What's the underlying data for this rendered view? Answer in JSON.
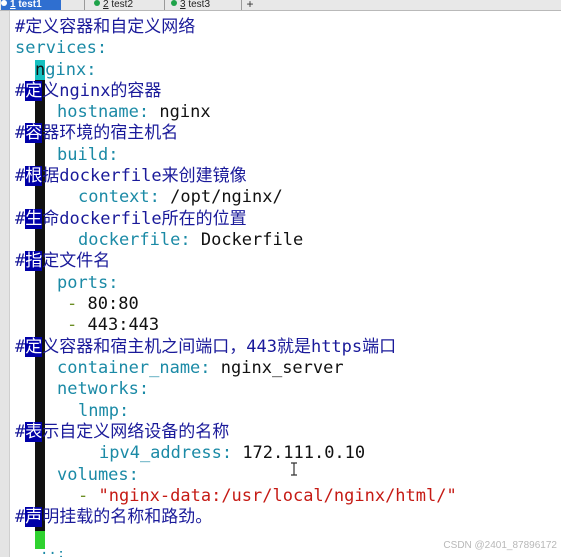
{
  "tabs": [
    {
      "num": "1",
      "label": "test1",
      "active": true
    },
    {
      "num": "2",
      "label": "test2",
      "active": false
    },
    {
      "num": "3",
      "label": "test3",
      "active": false
    }
  ],
  "new_tab_label": "+",
  "code_lines": [
    {
      "comment": "定义容器和自定义网络"
    },
    {
      "key": "services"
    },
    {
      "key_prefix": "n",
      "key": "ginx"
    },
    {
      "comment_first": "定",
      "comment": "义nginx的容器"
    },
    {
      "key": "hostname",
      "value": "nginx"
    },
    {
      "comment_first": "容",
      "comment": "器环境的宿主机名"
    },
    {
      "key": "build"
    },
    {
      "comment_first": "根",
      "comment": "据dockerfile来创建镜像"
    },
    {
      "key": "context",
      "value": "/opt/nginx/"
    },
    {
      "comment_first": "生",
      "comment": "命dockerfile所在的位置"
    },
    {
      "key": "dockerfile",
      "value": "Dockerfile"
    },
    {
      "comment_first": "指",
      "comment": "定文件名"
    },
    {
      "key": "ports"
    },
    {
      "dash": "-",
      "value": "80:80"
    },
    {
      "dash": "-",
      "value": "443:443"
    },
    {
      "comment_first": "定",
      "comment": "义容器和宿主机之间端口，443就是https端口"
    },
    {
      "key": "container_name",
      "value": "nginx_server"
    },
    {
      "key": "networks"
    },
    {
      "key": "lnmp"
    },
    {
      "comment_first": "表",
      "comment": "示自定义网络设备的名称"
    },
    {
      "key": "ipv4_address",
      "value": "172.111.0.10"
    },
    {
      "key": "volumes"
    },
    {
      "dash": "-",
      "value": "\"nginx-data:/usr/local/nginx/html/\""
    },
    {
      "comment_first": "声",
      "comment": "明挂载的名称和路劲。"
    }
  ],
  "bottom_partial": "··:",
  "watermark": "CSDN @2401_87896172",
  "colors": {
    "comment": "#1a1a9a",
    "key": "#1b8aa6",
    "string": "#c51a14",
    "active_tab": "#2f6fd0",
    "cursor_block": "#0000a8",
    "cursor_line": "#2fd22f"
  }
}
